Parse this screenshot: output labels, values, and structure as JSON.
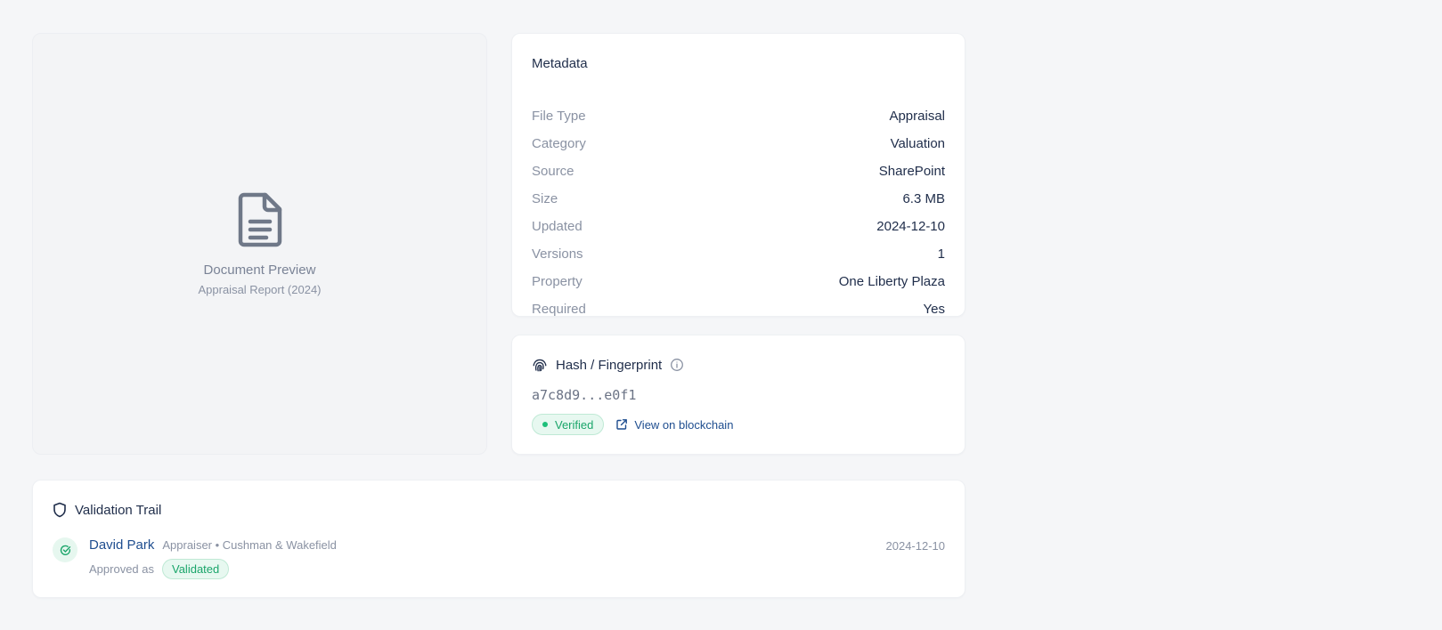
{
  "preview": {
    "title": "Document Preview",
    "subtitle": "Appraisal Report (2024)",
    "icon": "document-icon"
  },
  "metadata": {
    "title": "Metadata",
    "rows": [
      {
        "key": "File Type",
        "value": "Appraisal"
      },
      {
        "key": "Category",
        "value": "Valuation"
      },
      {
        "key": "Source",
        "value": "SharePoint"
      },
      {
        "key": "Size",
        "value": "6.3 MB"
      },
      {
        "key": "Updated",
        "value": "2024-12-10"
      },
      {
        "key": "Versions",
        "value": "1"
      },
      {
        "key": "Property",
        "value": "One Liberty Plaza"
      },
      {
        "key": "Required",
        "value": "Yes"
      }
    ]
  },
  "hash": {
    "title": "Hash / Fingerprint",
    "value": "a7c8d9...e0f1",
    "status_label": "Verified",
    "link_label": "View on blockchain",
    "icons": [
      "fingerprint-icon",
      "info-icon",
      "external-link-icon"
    ]
  },
  "trail": {
    "title": "Validation Trail",
    "entries": [
      {
        "name": "David Park",
        "role": "Appraiser • Cushman & Wakefield",
        "date": "2024-12-10",
        "approved_prefix": "Approved as",
        "status": "Validated"
      }
    ]
  },
  "colors": {
    "background": "#f5f6f8",
    "text_primary": "#1f2d4a",
    "text_muted": "#8a92a3",
    "link": "#1e4d8f",
    "success": "#1aa56a",
    "success_bg": "#e7f8f0"
  }
}
